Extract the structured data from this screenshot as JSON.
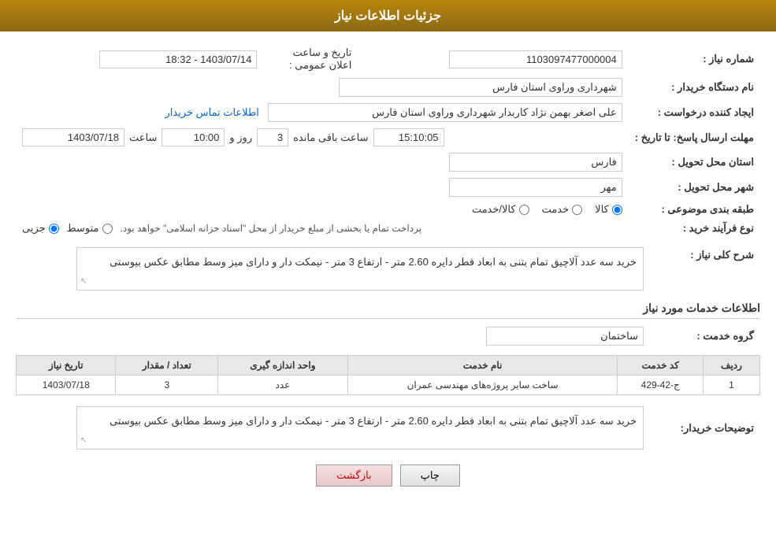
{
  "header": {
    "title": "جزئیات اطلاعات نیاز"
  },
  "fields": {
    "shomare_niaz_label": "شماره نیاز :",
    "shomare_niaz_value": "1103097477000004",
    "name_dastgah_label": "نام دستگاه خریدار :",
    "name_dastgah_value": "شهرداری وراوی استان فارس",
    "ijad_label": "ایجاد کننده درخواست :",
    "ijad_value": "علی اصغر بهمن نژاد کاربدار  شهرداری وراوی استان فارس",
    "mohlat_label": "مهلت ارسال پاسخ: تا تاریخ :",
    "mohlat_date": "1403/07/18",
    "mohlat_saat_label": "ساعت",
    "mohlat_saat": "10:00",
    "mohlat_rooz_label": "روز و",
    "mohlat_rooz": "3",
    "mohlat_mande_label": "ساعت باقی مانده",
    "mohlat_mande_value": "15:10:05",
    "ostan_label": "استان محل تحویل :",
    "ostan_value": "فارس",
    "shahr_label": "شهر محل تحویل :",
    "shahr_value": "مهر",
    "tabaqe_label": "طبقه بندی موضوعی :",
    "tabaqe_options": [
      "خدمت",
      "کالا/خدمت",
      "کالا"
    ],
    "tabaqe_selected": "کالا",
    "nooe_label": "نوع فرآیند خرید :",
    "nooe_options": [
      "جزیی",
      "متوسط"
    ],
    "nooe_note": "پرداخت تمام یا بخشی از مبلغ خریدار از محل \"اسناد خزانه اسلامی\" خواهد بود.",
    "sharh_label": "شرح کلی نیاز :",
    "sharh_value": "خرید سه عدد آلاچیق تمام بتنی به ابعاد قطر دایره 2.60 متر - ارتفاع 3 متر - نیمکت دار و دارای میز وسط مطابق عکس بیوستی",
    "khadamat_label": "اطلاعات خدمات مورد نیاز",
    "gorohe_label": "گروه خدمت :",
    "gorohe_value": "ساختمان",
    "etelaat_label": "اطلاعات تماس خریدار",
    "table_headers": {
      "radif": "ردیف",
      "code": "کد خدمت",
      "name": "نام خدمت",
      "unit": "واحد اندازه گیری",
      "tedad": "تعداد / مقدار",
      "tarikh": "تاریخ نیاز"
    },
    "table_rows": [
      {
        "radif": "1",
        "code": "ج-42-429",
        "name": "ساخت سایر پروژه‌های مهندسی عمران",
        "unit": "عدد",
        "tedad": "3",
        "tarikh": "1403/07/18"
      }
    ],
    "tozihat_label": "توضیحات خریدار:",
    "tozihat_value": "خرید سه عدد آلاچیق تمام بتنی به ابعاد قطر دایره 2.60 متر - ارتفاع 3 متر - نیمکت دار و دارای میز وسط مطابق عکس بیوستی",
    "btn_back": "بازگشت",
    "btn_print": "چاپ"
  }
}
